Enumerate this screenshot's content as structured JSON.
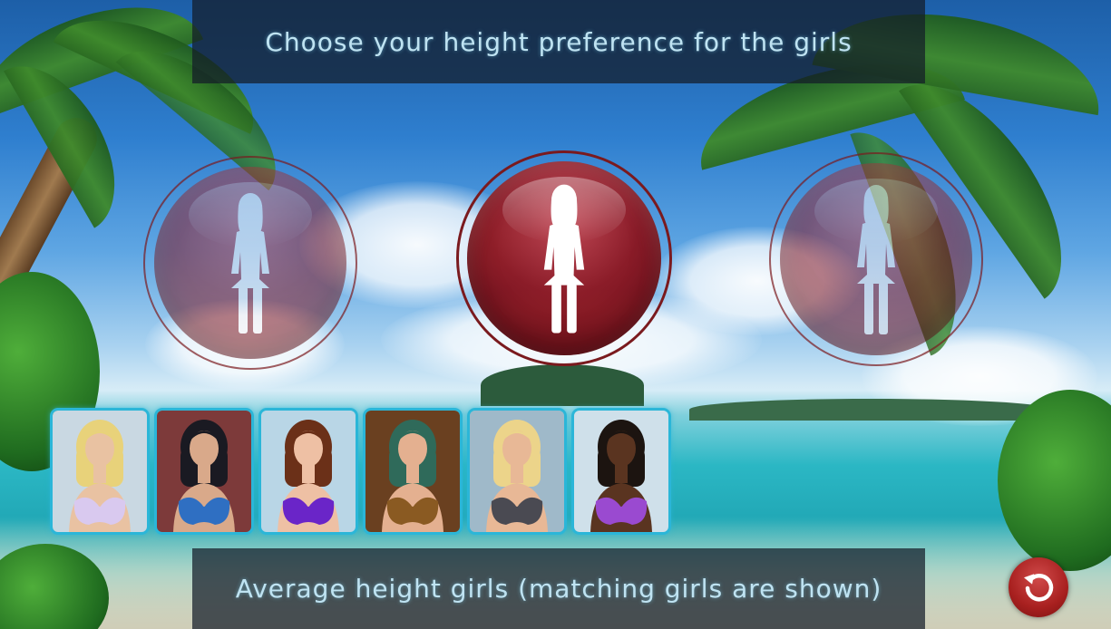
{
  "header": {
    "title": "Choose your height preference for the girls"
  },
  "height_options": [
    {
      "id": "short",
      "state": "unselected"
    },
    {
      "id": "average",
      "state": "selected"
    },
    {
      "id": "tall",
      "state": "unselected"
    }
  ],
  "footer": {
    "status": "Average height girls (matching girls are shown)"
  },
  "thumbnails": [
    {
      "hair": "#e8d27a",
      "skin": "#e9c2a2",
      "top": "#d9c9ef",
      "bg": "#c9d8e2"
    },
    {
      "hair": "#1a1a22",
      "skin": "#d9a98a",
      "top": "#2f6fc2",
      "bg": "#7d3a3a"
    },
    {
      "hair": "#6b3018",
      "skin": "#eec0a4",
      "top": "#6a25c8",
      "bg": "#b9d6e6"
    },
    {
      "hair": "#2f6a5a",
      "skin": "#e4b090",
      "top": "#8a5a22",
      "bg": "#6a4020"
    },
    {
      "hair": "#ecd48a",
      "skin": "#e8b896",
      "top": "#4a4a52",
      "bg": "#9fb9c9"
    },
    {
      "hair": "#1c1410",
      "skin": "#5a3420",
      "top": "#9a4ad0",
      "bg": "#cfe0ea"
    }
  ],
  "colors": {
    "accent_red": "#8c1520",
    "thumb_border": "#2bb6d8",
    "text": "#bfe3f2"
  },
  "icons": {
    "reset": "reset-icon",
    "silhouette": "woman-silhouette-icon"
  }
}
